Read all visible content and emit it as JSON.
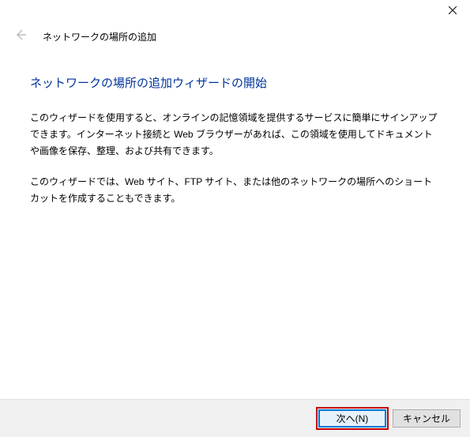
{
  "titlebar": {
    "close_label": "閉じる"
  },
  "header": {
    "back_label": "戻る",
    "title": "ネットワークの場所の追加"
  },
  "content": {
    "heading": "ネットワークの場所の追加ウィザードの開始",
    "paragraph1": "このウィザードを使用すると、オンラインの記憶領域を提供するサービスに簡単にサインアップできます。インターネット接続と Web ブラウザーがあれば、この領域を使用してドキュメントや画像を保存、整理、および共有できます。",
    "paragraph2": "このウィザードでは、Web サイト、FTP サイト、または他のネットワークの場所へのショートカットを作成することもできます。"
  },
  "footer": {
    "next_label": "次へ(N)",
    "cancel_label": "キャンセル"
  }
}
